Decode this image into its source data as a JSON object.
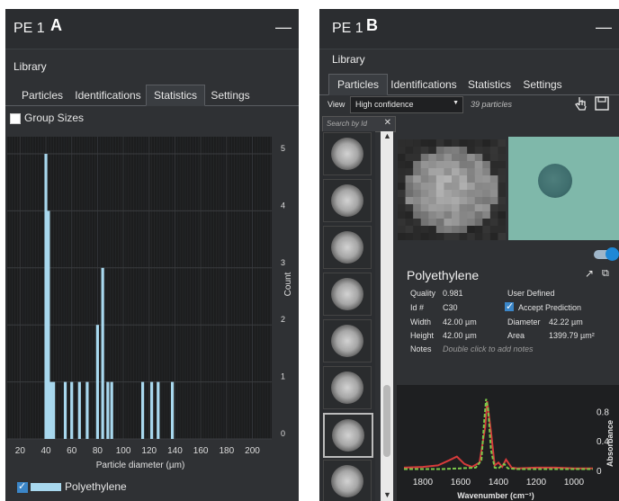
{
  "panel_a": {
    "title": "PE 1",
    "letter": "A",
    "minimize_icon": "minus-icon",
    "library_label": "Library",
    "tabs": [
      {
        "label": "Particles",
        "active": false
      },
      {
        "label": "Identifications",
        "active": false
      },
      {
        "label": "Statistics",
        "active": true
      },
      {
        "label": "Settings",
        "active": false
      }
    ],
    "group_sizes_label": "Group Sizes",
    "group_sizes_checked": false,
    "legend_label": "Polyethylene",
    "legend_checked": true,
    "colors": {
      "bar": "#a8d8ee",
      "bg": "#1c1d1e"
    }
  },
  "chart_data": {
    "type": "bar",
    "xlabel": "Particle diameter (µm)",
    "ylabel": "Count",
    "xlim": [
      10,
      215
    ],
    "ylim": [
      0,
      5.3
    ],
    "x_ticks": [
      "20",
      "40",
      "60",
      "80",
      "100",
      "120",
      "140",
      "160",
      "180",
      "200"
    ],
    "y_ticks": [
      "0",
      "1",
      "2",
      "3",
      "4",
      "5"
    ],
    "series": [
      {
        "name": "Polyethylene",
        "bars": [
          {
            "x": 40,
            "value": 5
          },
          {
            "x": 42,
            "value": 4
          },
          {
            "x": 44,
            "value": 1
          },
          {
            "x": 46,
            "value": 1
          },
          {
            "x": 55,
            "value": 1
          },
          {
            "x": 60,
            "value": 1
          },
          {
            "x": 66,
            "value": 1
          },
          {
            "x": 72,
            "value": 1
          },
          {
            "x": 80,
            "value": 2
          },
          {
            "x": 84,
            "value": 3
          },
          {
            "x": 88,
            "value": 1
          },
          {
            "x": 91,
            "value": 1
          },
          {
            "x": 115,
            "value": 1
          },
          {
            "x": 122,
            "value": 1
          },
          {
            "x": 127,
            "value": 1
          },
          {
            "x": 138,
            "value": 1
          }
        ]
      }
    ],
    "spectrum": {
      "type": "line",
      "xlabel": "Wavenumber (cm⁻¹)",
      "ylabel": "Absorbance",
      "xlim": [
        1900,
        900
      ],
      "ylim": [
        0,
        1.0
      ],
      "x_ticks": [
        "1800",
        "1600",
        "1400",
        "1200",
        "1000"
      ],
      "y_ticks": [
        "0",
        "0.4",
        "0.8"
      ],
      "series": [
        {
          "name": "",
          "color": "#d63b3b",
          "x": [
            1900,
            1800,
            1720,
            1660,
            1620,
            1580,
            1540,
            1500,
            1470,
            1460,
            1440,
            1420,
            1400,
            1380,
            1360,
            1330,
            1300,
            1200,
            1100,
            1000,
            900
          ],
          "y": [
            0.05,
            0.06,
            0.08,
            0.15,
            0.2,
            0.1,
            0.06,
            0.12,
            0.6,
            0.95,
            0.55,
            0.08,
            0.12,
            0.06,
            0.16,
            0.05,
            0.04,
            0.05,
            0.05,
            0.04,
            0.04
          ]
        },
        {
          "name": "",
          "color": "#7cc84a",
          "x": [
            1900,
            1800,
            1700,
            1600,
            1520,
            1490,
            1475,
            1465,
            1455,
            1440,
            1420,
            1400,
            1380,
            1370,
            1350,
            1300,
            1200,
            1100,
            1000,
            900
          ],
          "y": [
            0.03,
            0.03,
            0.03,
            0.04,
            0.05,
            0.15,
            0.7,
            0.98,
            0.85,
            0.3,
            0.05,
            0.04,
            0.08,
            0.1,
            0.04,
            0.03,
            0.03,
            0.03,
            0.03,
            0.03
          ]
        }
      ]
    }
  },
  "panel_b": {
    "title": "PE 1",
    "letter": "B",
    "minimize_icon": "minus-icon",
    "library_label": "Library",
    "tabs": [
      {
        "label": "Particles",
        "active": true
      },
      {
        "label": "Identifications",
        "active": false
      },
      {
        "label": "Statistics",
        "active": false
      },
      {
        "label": "Settings",
        "active": false
      }
    ],
    "view_label": "View",
    "view_select": "High confidence",
    "particle_count": "39 particles",
    "search_placeholder": "Search by Id",
    "particle_name": "Polyethylene",
    "details": {
      "quality_label": "Quality",
      "quality_value": "0.981",
      "id_label": "Id #",
      "id_value": "C30",
      "width_label": "Width",
      "width_value": "42.00 µm",
      "height_label": "Height",
      "height_value": "42.00 µm",
      "notes_label": "Notes",
      "notes_placeholder": "Double click to add notes",
      "user_defined_label": "User Defined",
      "accept_prediction_label": "Accept Prediction",
      "diameter_label": "Diameter",
      "diameter_value": "42.22 µm",
      "area_label": "Area",
      "area_value": "1399.79 µm²"
    },
    "colors": {
      "accent": "#1e88d6",
      "optical_bg": "#7fb8aa"
    }
  }
}
